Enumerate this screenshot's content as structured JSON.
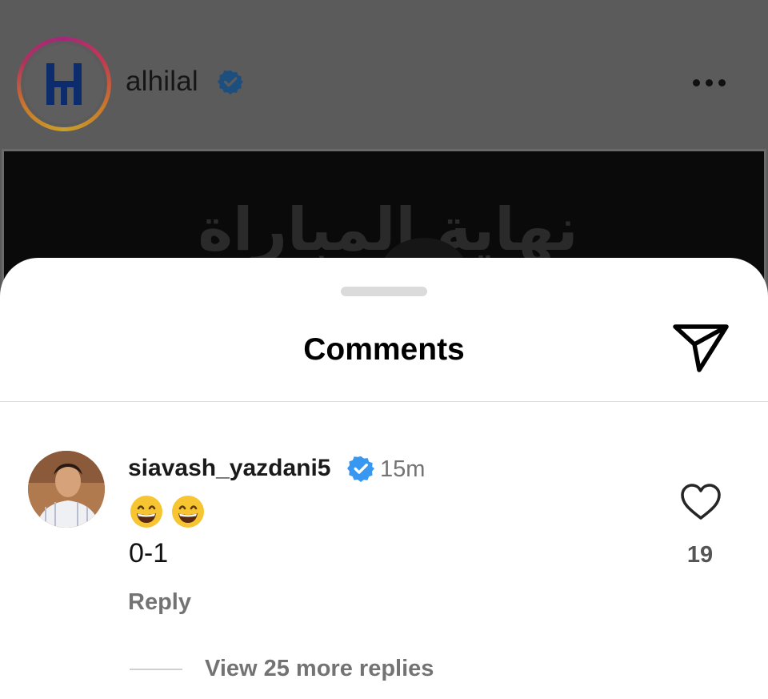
{
  "post": {
    "username": "alhilal",
    "image_text": "نهاية المباراة"
  },
  "sheet": {
    "title": "Comments"
  },
  "comment": {
    "username": "siavash_yazdani5",
    "time": "15m",
    "emojis": [
      "grinning-face-emoji",
      "grinning-face-emoji"
    ],
    "text": "0-1",
    "reply_label": "Reply",
    "like_count": "19",
    "view_replies_label": "View 25 more replies"
  },
  "colors": {
    "verified": "#3897f0",
    "muted_text": "#737373",
    "overlay": "#5a5a5a"
  }
}
